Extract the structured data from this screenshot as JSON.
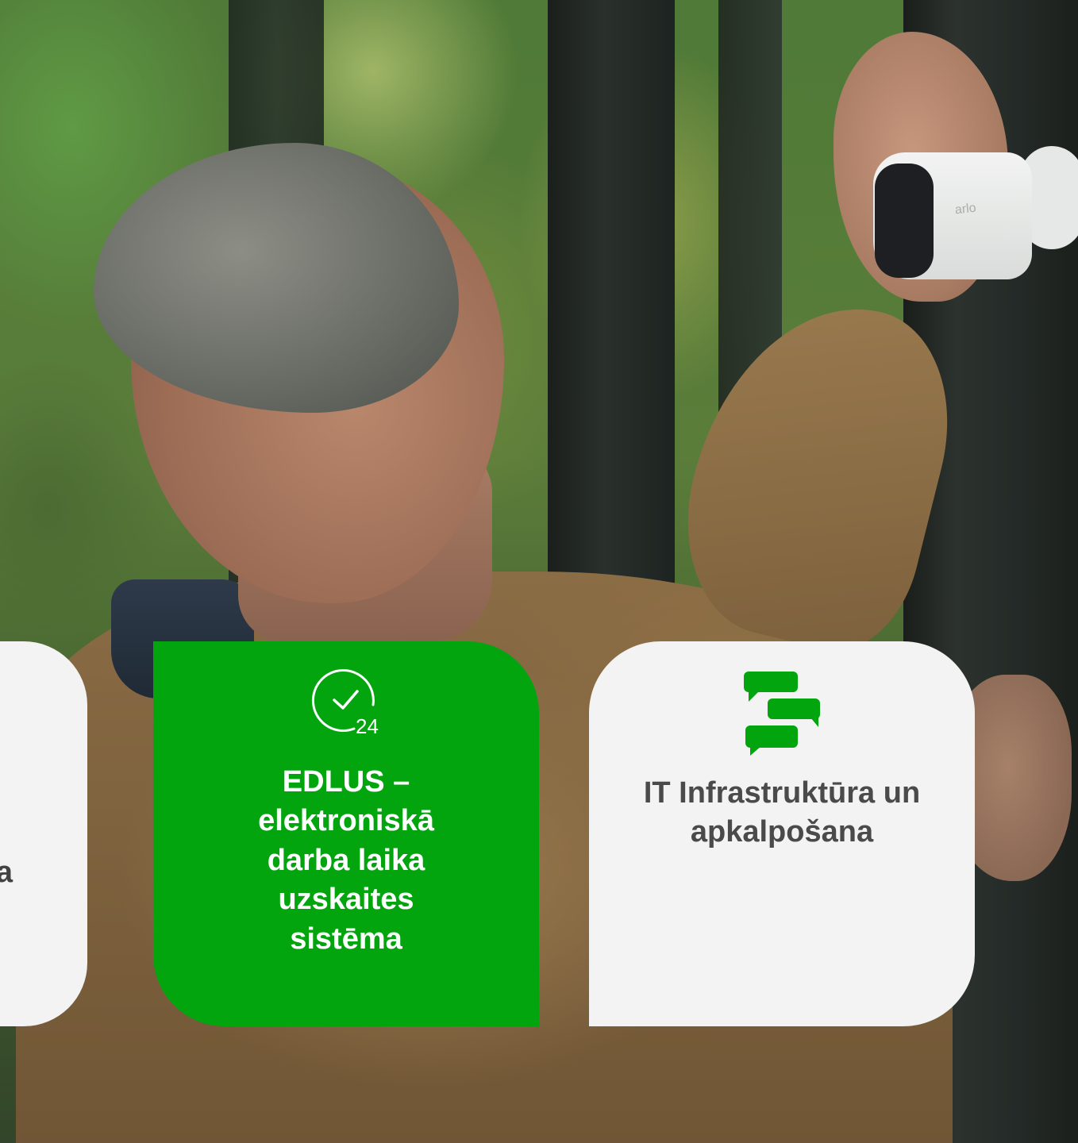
{
  "hero": {
    "camera_logo": "arlo"
  },
  "cards": {
    "left": {
      "partial_text": "a"
    },
    "edlus": {
      "icon": "clock-check-24-icon",
      "icon_text": "24",
      "title": "EDLUS – elektroniskā darba laika uzskaites sistēma",
      "background": "#03a50f"
    },
    "it": {
      "icon": "chat-bubbles-icon",
      "title": "IT Infrastruktūra un apkalpošana",
      "background": "#f3f3f3",
      "icon_color": "#03a50f"
    }
  }
}
